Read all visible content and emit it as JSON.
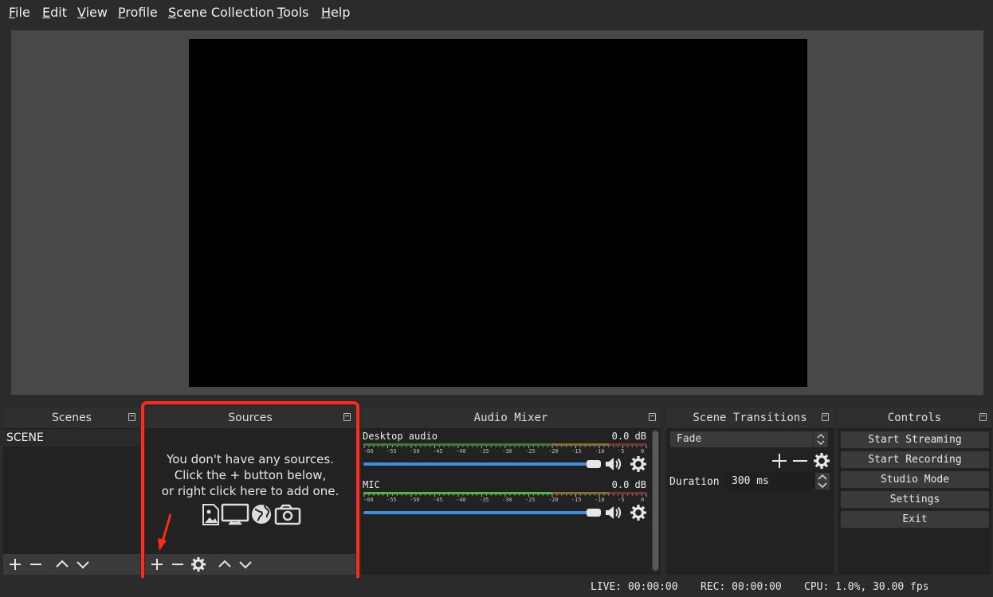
{
  "menu": [
    {
      "label": "File",
      "mnemonic": "F",
      "rest": "ile"
    },
    {
      "label": "Edit",
      "mnemonic": "E",
      "rest": "dit"
    },
    {
      "label": "View",
      "mnemonic": "V",
      "rest": "iew"
    },
    {
      "label": "Profile",
      "mnemonic": "P",
      "rest": "rofile"
    },
    {
      "label": "Scene Collection",
      "mnemonic": "S",
      "rest": "cene Collection"
    },
    {
      "label": "Tools",
      "mnemonic": "T",
      "rest": "ools"
    },
    {
      "label": "Help",
      "mnemonic": "H",
      "rest": "elp"
    }
  ],
  "scenes": {
    "title": "Scenes",
    "items": [
      "SCENE"
    ]
  },
  "sources": {
    "title": "Sources",
    "empty_line1": "You don't have any sources.",
    "empty_line2": "Click the + button below,",
    "empty_line3": "or right click here to add one."
  },
  "audio_mixer": {
    "title": "Audio Mixer",
    "ticks": [
      "-60",
      "-55",
      "-50",
      "-45",
      "-40",
      "-35",
      "-30",
      "-25",
      "-20",
      "-15",
      "-10",
      "-5",
      "0"
    ],
    "channels": [
      {
        "name": "Desktop audio",
        "db": "0.0 dB",
        "volume": 1.0
      },
      {
        "name": "MIC",
        "db": "0.0 dB",
        "volume": 1.0
      }
    ]
  },
  "transitions": {
    "title": "Scene Transitions",
    "selected": "Fade",
    "duration_label": "Duration",
    "duration_value": "300 ms"
  },
  "controls": {
    "title": "Controls",
    "buttons": [
      "Start Streaming",
      "Start Recording",
      "Studio Mode",
      "Settings",
      "Exit"
    ]
  },
  "status": {
    "live": "LIVE: 00:00:00",
    "rec": "REC: 00:00:00",
    "cpu": "CPU: 1.0%, 30.00 fps"
  },
  "colors": {
    "highlight": "#ff2a1a",
    "slider": "#3f8ee0",
    "meter_green": "#57c443",
    "meter_yellow": "#c9b63a",
    "meter_red": "#c2413a"
  }
}
